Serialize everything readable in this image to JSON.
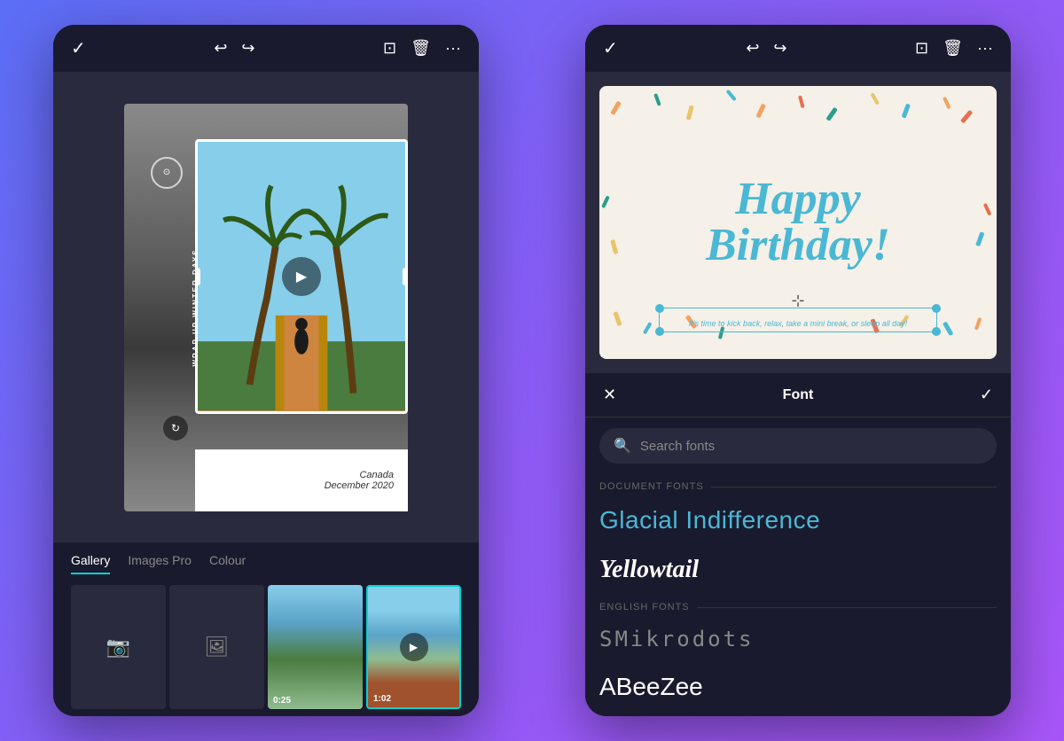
{
  "left_panel": {
    "toolbar": {
      "check": "✓",
      "undo": "↩",
      "redo": "↪",
      "crop": "⊡",
      "delete": "🗑",
      "more": "···"
    },
    "canvas": {
      "vertical_text": "WRAP UP WINTER DAYS",
      "country": "Canada",
      "date": "December 2020"
    },
    "tabs": {
      "items": [
        "Gallery",
        "Images Pro",
        "Colour"
      ],
      "active": "Gallery"
    },
    "media": {
      "video1_duration": "0:25",
      "video2_duration": "1:02"
    }
  },
  "right_panel": {
    "toolbar": {
      "check": "✓",
      "undo": "↩",
      "redo": "↪",
      "copy": "⊡",
      "delete": "🗑",
      "more": "···"
    },
    "card": {
      "happy": "Happy",
      "birthday": "Birthday!",
      "subtitle": "It's time to kick back, relax,\ntake a mini break, or sleep all day!"
    },
    "font_panel": {
      "title": "Font",
      "close": "✕",
      "check": "✓",
      "search_placeholder": "Search fonts",
      "sections": [
        {
          "label": "DOCUMENT FONTS",
          "fonts": [
            {
              "name": "Glacial Indifference",
              "style": "glacial"
            },
            {
              "name": "Yellowtail",
              "style": "yellowtail"
            }
          ]
        },
        {
          "label": "ENGLISH FONTS",
          "fonts": [
            {
              "name": "SMikrodots",
              "style": "dots"
            },
            {
              "name": "ABeeZee",
              "style": "abeezee"
            }
          ]
        }
      ]
    }
  },
  "colors": {
    "accent": "#4ab8d4",
    "background_gradient_start": "#5b6ef5",
    "background_gradient_end": "#a855f7",
    "panel_bg": "#1a1a2e",
    "card_bg": "#f5f0e8"
  }
}
